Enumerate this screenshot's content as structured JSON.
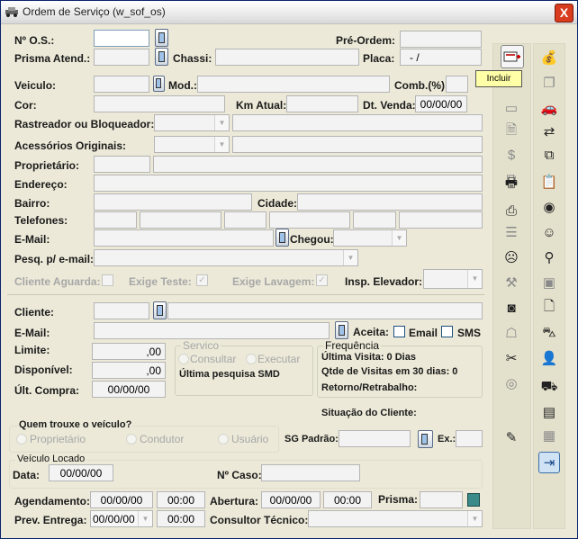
{
  "window": {
    "title": "Ordem de Serviço (w_sof_os)",
    "close": "X"
  },
  "labels": {
    "os": "Nº O.S.:",
    "preordem": "Pré-Ordem:",
    "prisma": "Prisma Atend.:",
    "chassi": "Chassi:",
    "placa": "Placa:",
    "veiculo": "Veiculo:",
    "mod": "Mod.:",
    "comb": "Comb.(%):",
    "cor": "Cor:",
    "km": "Km Atual:",
    "dtvenda": "Dt. Venda:",
    "rastreador": "Rastreador ou Bloqueador:",
    "acessorios": "Acessórios Originais:",
    "proprietario": "Proprietário:",
    "endereco": "Endereço:",
    "bairro": "Bairro:",
    "cidade": "Cidade:",
    "telefones": "Telefones:",
    "email": "E-Mail:",
    "chegou": "Chegou:",
    "pesq": "Pesq. p/ e-mail:",
    "cliente_aguarda": "Cliente Aguarda:",
    "exige_teste": "Exige Teste:",
    "exige_lavagem": "Exige Lavagem:",
    "insp_elevador": "Insp. Elevador:",
    "cliente": "Cliente:",
    "email2": "E-Mail:",
    "aceita": "Aceita:",
    "email_opt": "Email",
    "sms_opt": "SMS",
    "limite": "Limite:",
    "disponivel": "Disponível:",
    "ult_compra": "Últ. Compra:",
    "frequencia": "Frequência",
    "ultima_visita": "Última Visita: 0 Dias",
    "qtde_visitas": "Qtde de Visitas em 30 dias: 0",
    "retorno": "Retorno/Retrabalho:",
    "servico": "Servico",
    "consultar": "Consultar",
    "executar": "Executar",
    "ultima_pesquisa": "Última pesquisa SMD",
    "situacao": "Situação do Cliente:",
    "quem_trouxe": "Quem trouxe o veículo?",
    "opt_proprietario": "Proprietário",
    "opt_condutor": "Condutor",
    "opt_usuario": "Usuário",
    "sg_padrao": "SG Padrão:",
    "ex": "Ex.:",
    "veiculo_locado": "Veículo Locado",
    "data": "Data:",
    "n_caso": "Nº Caso:",
    "agendamento": "Agendamento:",
    "abertura": "Abertura:",
    "prisma2": "Prisma:",
    "prev_entrega": "Prev. Entrega:",
    "consultor": "Consultor Técnico:"
  },
  "values": {
    "placa": "-   /",
    "dt_venda": "00/00/00",
    "limite": ",00",
    "disponivel": ",00",
    "ult_compra": "00/00/00",
    "data_locado": "00/00/00",
    "agend_data": "00/00/00",
    "agend_hora": "00:00",
    "abert_data": "00/00/00",
    "abert_hora": "00:00",
    "prev_data": "00/00/00",
    "prev_hora": "00:00"
  },
  "tooltip": "Incluir"
}
